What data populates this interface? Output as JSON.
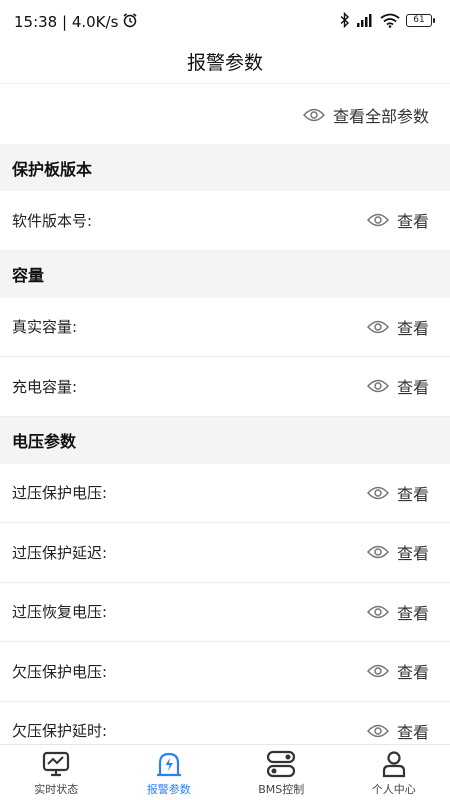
{
  "status_bar": {
    "time_speed": "15:38 | 4.0K/s",
    "battery": "61"
  },
  "header": {
    "title": "报警参数"
  },
  "view_all_label": "查看全部参数",
  "view_label": "查看",
  "sections": [
    {
      "title": "保护板版本",
      "rows": [
        {
          "label": "软件版本号:"
        }
      ]
    },
    {
      "title": "容量",
      "rows": [
        {
          "label": "真实容量:"
        },
        {
          "label": "充电容量:"
        }
      ]
    },
    {
      "title": "电压参数",
      "rows": [
        {
          "label": "过压保护电压:"
        },
        {
          "label": "过压保护延迟:"
        },
        {
          "label": "过压恢复电压:"
        },
        {
          "label": "欠压保护电压:"
        },
        {
          "label": "欠压保护延时:"
        }
      ]
    }
  ],
  "tabs": [
    {
      "label": "实时状态",
      "icon": "monitor-chart-icon",
      "active": false
    },
    {
      "label": "报警参数",
      "icon": "alarm-light-icon",
      "active": true
    },
    {
      "label": "BMS控制",
      "icon": "toggle-switch-icon",
      "active": false
    },
    {
      "label": "个人中心",
      "icon": "person-icon",
      "active": false
    }
  ],
  "colors": {
    "accent": "#2d7ff9",
    "section_bg": "#f4f4f4",
    "divider": "#eeeeee"
  }
}
